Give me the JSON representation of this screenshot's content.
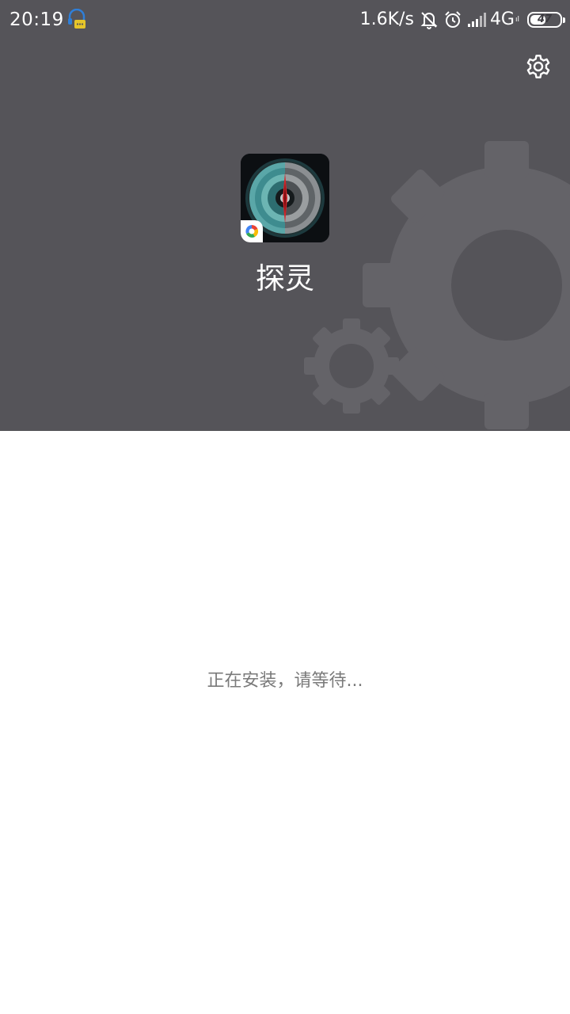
{
  "status_bar": {
    "time": "20:19",
    "net_speed": "1.6K/s",
    "network_type": "4G",
    "network_sub": "ıl",
    "battery_level": "47",
    "icons": [
      "headset-chat-icon",
      "bell-off-icon",
      "alarm-icon",
      "signal-icon",
      "battery-icon"
    ]
  },
  "header": {
    "app_name": "探灵",
    "settings_icon": "gear-icon",
    "background_color": "#555459",
    "gear_color": "#646368"
  },
  "app_icon": {
    "name": "compass-app-icon",
    "badge": "store-badge-icon"
  },
  "main": {
    "install_status": "正在安装，请等待..."
  }
}
